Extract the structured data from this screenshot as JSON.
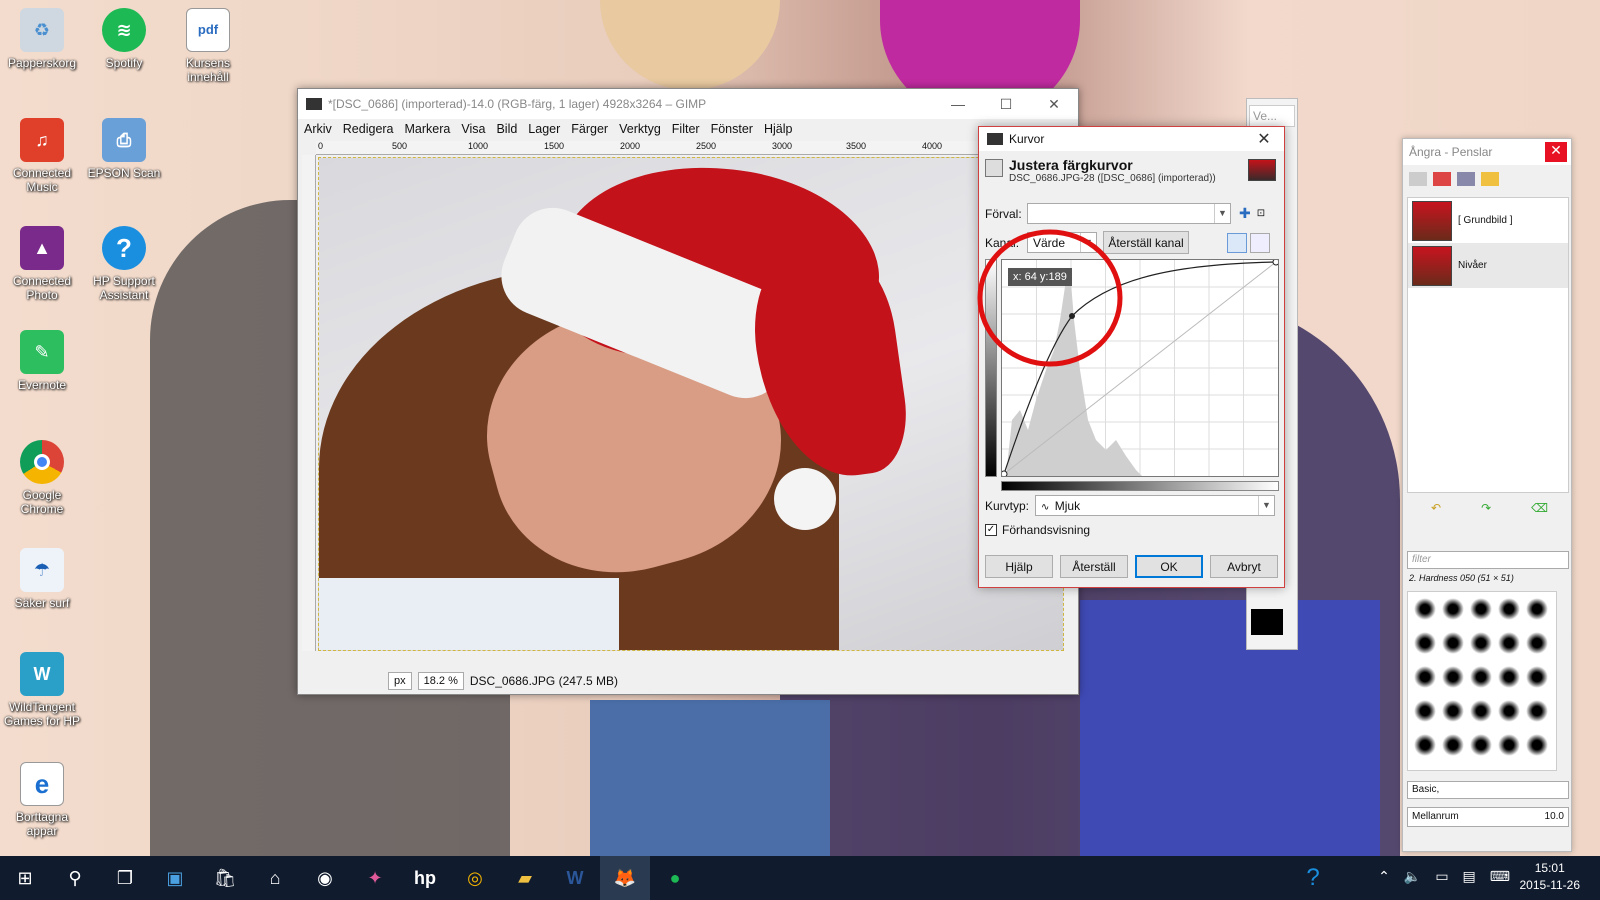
{
  "desktop_icons": [
    {
      "label": "Papperskorg",
      "icon": "recycle-bin-icon"
    },
    {
      "label": "Spotify",
      "icon": "spotify-icon"
    },
    {
      "label": "Kursens innehåll",
      "icon": "pdf-icon"
    },
    {
      "label": "Connected Music",
      "icon": "hp-music-icon"
    },
    {
      "label": "EPSON Scan",
      "icon": "scanner-icon"
    },
    {
      "label": "Connected Photo",
      "icon": "hp-photo-icon"
    },
    {
      "label": "HP Support Assistant",
      "icon": "help-icon"
    },
    {
      "label": "Evernote",
      "icon": "evernote-icon"
    },
    {
      "label": "Google Chrome",
      "icon": "chrome-icon"
    },
    {
      "label": "Säker surf",
      "icon": "secure-surf-icon"
    },
    {
      "label": "WildTangent Games for HP",
      "icon": "games-icon"
    },
    {
      "label": "Borttagna appar",
      "icon": "edge-icon"
    }
  ],
  "gimp": {
    "title": "*[DSC_0686] (importerad)-14.0 (RGB-färg, 1 lager) 4928x3264 – GIMP",
    "menu": [
      "Arkiv",
      "Redigera",
      "Markera",
      "Visa",
      "Bild",
      "Lager",
      "Färger",
      "Verktyg",
      "Filter",
      "Fönster",
      "Hjälp"
    ],
    "ruler_ticks": [
      "0",
      "500",
      "1000",
      "1500",
      "2000",
      "2500",
      "3000",
      "3500",
      "4000"
    ],
    "unit": "px",
    "zoom": "18.2 %",
    "status": "DSC_0686.JPG (247.5 MB)"
  },
  "ve_tab": "Ve...",
  "curves": {
    "window_title": "Kurvor",
    "heading": "Justera färgkurvor",
    "subheading": "DSC_0686.JPG-28 ([DSC_0686] (importerad))",
    "preset_label": "Förval:",
    "preset_value": "",
    "channel_label": "Kanal:",
    "channel_value": "Värde",
    "reset_channel_button": "Återställ kanal",
    "tooltip": "x: 64 y:189",
    "curve_type_label": "Kurvtyp:",
    "curve_type_value": "Mjuk",
    "preview_label": "Förhandsvisning",
    "preview_checked": true,
    "buttons": {
      "help": "Hjälp",
      "reset": "Återställ",
      "ok": "OK",
      "cancel": "Avbryt"
    },
    "annotation_color": "#e01010"
  },
  "dock": {
    "title": "Ångra - Penslar",
    "history": [
      "[ Grundbild ]",
      "Nivåer"
    ],
    "brush_filter_placeholder": "filter",
    "brush_name": "2. Hardness 050 (51 × 51)",
    "brush_tag": "Basic,",
    "spacing_label": "Mellanrum",
    "spacing_value": "10.0"
  },
  "taskbar": {
    "time": "15:01",
    "date": "2015-11-26"
  }
}
